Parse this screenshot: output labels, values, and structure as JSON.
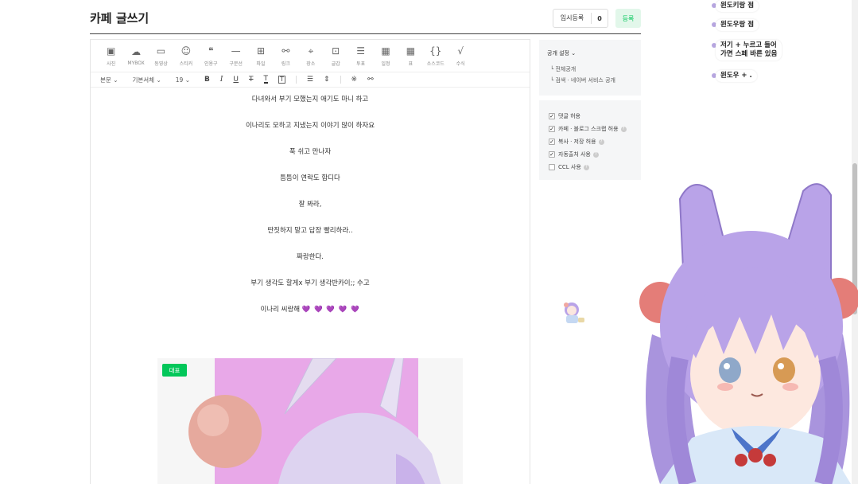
{
  "header": {
    "title": "카페 글쓰기",
    "save_label": "임시등록",
    "save_count": "0",
    "register_label": "등록"
  },
  "toolbar": {
    "items": [
      {
        "label": "사진",
        "icon": "image-icon"
      },
      {
        "label": "MYBOX",
        "icon": "cloud-icon"
      },
      {
        "label": "동영상",
        "icon": "video-icon"
      },
      {
        "label": "스티커",
        "icon": "sticker-icon"
      },
      {
        "label": "인용구",
        "icon": "quote-icon"
      },
      {
        "label": "구분선",
        "icon": "divider-icon"
      },
      {
        "label": "파일",
        "icon": "file-icon"
      },
      {
        "label": "링크",
        "icon": "link-icon"
      },
      {
        "label": "장소",
        "icon": "place-icon"
      },
      {
        "label": "글감",
        "icon": "material-icon"
      },
      {
        "label": "투표",
        "icon": "vote-icon"
      },
      {
        "label": "일정",
        "icon": "calendar-icon"
      },
      {
        "label": "표",
        "icon": "table-icon"
      },
      {
        "label": "소스코드",
        "icon": "code-icon"
      },
      {
        "label": "수식",
        "icon": "formula-icon"
      }
    ],
    "paragraph_style": "본문",
    "font": "기본서체",
    "font_size": "19"
  },
  "content": {
    "paragraphs": [
      "다녀와서 부기 모했는지 애기도 마니 하고",
      "이나리도 모하고 지냈는지 이야기 많이 하자요",
      "푹 쉬고 만나자",
      "틈틈이 연락도 합디다",
      "잘 봐라,",
      "딴짓하지 말고 답장 빨리하라..",
      "짜랑한다.",
      "부기 생각도 할게x 부기 생각반카이;; 수고",
      "이나리 씨랑해"
    ],
    "hearts": "💜 💜 💜 💜 💜",
    "cover_badge": "대표"
  },
  "sidebar": {
    "publish_title": "공개 설정",
    "publish_options": [
      "전체공개",
      "검색 · 네이버 서비스 공개"
    ],
    "options": [
      {
        "label": "댓글 허용",
        "checked": true,
        "help": false
      },
      {
        "label": "카페 · 블로그 스크랩 허용",
        "checked": true,
        "help": true
      },
      {
        "label": "복사 · 저장 허용",
        "checked": true,
        "help": true
      },
      {
        "label": "자동출처 사용",
        "checked": true,
        "help": true
      },
      {
        "label": "CCL 사용",
        "checked": false,
        "help": true
      }
    ]
  },
  "chat": {
    "messages": [
      "윈도키랑 점",
      "윈도우랑 점",
      "저기 + 누르고 들어\n가면 스페 바른 있음",
      "윈도우 + ."
    ]
  },
  "colors": {
    "brand_green": "#03c75a",
    "heart_purple": "#7b3fd1",
    "hair_lavender": "#b9a3e8"
  }
}
